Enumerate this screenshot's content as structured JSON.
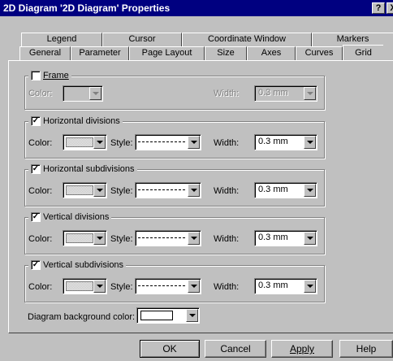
{
  "window": {
    "title": "2D Diagram '2D Diagram' Properties",
    "help_button": "?",
    "close_button": "X"
  },
  "tabs": {
    "back_row": [
      "Legend",
      "Cursor",
      "Coordinate Window",
      "Markers"
    ],
    "front_row": [
      "General",
      "Parameter",
      "Page Layout",
      "Size",
      "Axes",
      "Curves",
      "Grid"
    ],
    "active": "Grid"
  },
  "frame_group": {
    "title": "Frame",
    "checked": false,
    "color_label": "Color:",
    "width_label": "Width:",
    "width_value": "0.3 mm",
    "enabled": false
  },
  "groups": [
    {
      "title": "Horizontal divisions",
      "checked": true,
      "color_label": "Color:",
      "style_label": "Style:",
      "width_label": "Width:",
      "width_value": "0.3 mm"
    },
    {
      "title": "Horizontal subdivisions",
      "checked": true,
      "color_label": "Color:",
      "style_label": "Style:",
      "width_label": "Width:",
      "width_value": "0.3 mm"
    },
    {
      "title": "Vertical divisions",
      "checked": true,
      "color_label": "Color:",
      "style_label": "Style:",
      "width_label": "Width:",
      "width_value": "0.3 mm"
    },
    {
      "title": "Vertical subdivisions",
      "checked": true,
      "color_label": "Color:",
      "style_label": "Style:",
      "width_label": "Width:",
      "width_value": "0.3 mm"
    }
  ],
  "background": {
    "label": "Diagram background color:",
    "color": "#ffffff"
  },
  "buttons": {
    "ok": "OK",
    "cancel": "Cancel",
    "apply": "Apply",
    "help": "Help"
  },
  "colors": {
    "title_bar": "#000080",
    "face": "#c0c0c0"
  }
}
